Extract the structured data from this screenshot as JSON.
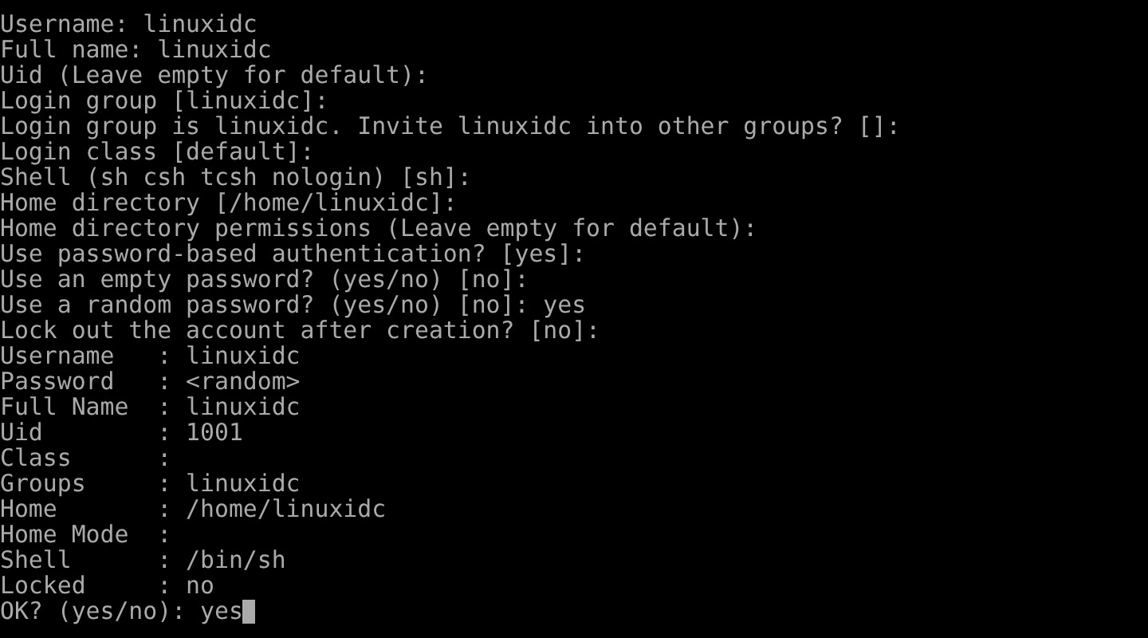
{
  "terminal": {
    "lines": [
      "Username: linuxidc",
      "Full name: linuxidc",
      "Uid (Leave empty for default):",
      "Login group [linuxidc]:",
      "Login group is linuxidc. Invite linuxidc into other groups? []:",
      "Login class [default]:",
      "Shell (sh csh tcsh nologin) [sh]:",
      "Home directory [/home/linuxidc]:",
      "Home directory permissions (Leave empty for default):",
      "Use password-based authentication? [yes]:",
      "Use an empty password? (yes/no) [no]:",
      "Use a random password? (yes/no) [no]: yes",
      "Lock out the account after creation? [no]:",
      "Username   : linuxidc",
      "Password   : <random>",
      "Full Name  : linuxidc",
      "Uid        : 1001",
      "Class      :",
      "Groups     : linuxidc",
      "Home       : /home/linuxidc",
      "Home Mode  :",
      "Shell      : /bin/sh",
      "Locked     : no",
      "OK? (yes/no): yes"
    ],
    "cursor_visible": true
  }
}
